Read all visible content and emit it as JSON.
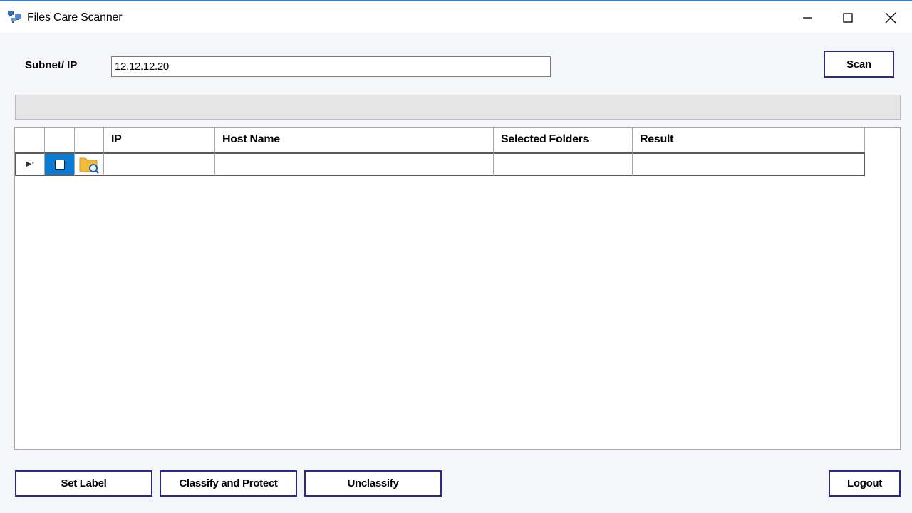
{
  "window": {
    "title": "Files Care Scanner",
    "icon": "network-computers-icon",
    "controls": [
      "minimize-icon",
      "maximize-icon",
      "close-icon"
    ],
    "accent_color": "#3b78d8"
  },
  "form": {
    "subnet_label": "Subnet/ IP",
    "subnet_value": "12.12.12.20",
    "scan_label": "Scan"
  },
  "progress": {
    "value_percent": 0
  },
  "grid": {
    "columns": [
      "",
      "",
      "",
      "IP",
      "Host Name",
      "Selected Folders",
      "Result"
    ],
    "new_row": {
      "marker": "▶*",
      "checked": false,
      "ip": "",
      "host_name": "",
      "selected_folders": "",
      "result": ""
    },
    "selection_color": "#0a7bd4"
  },
  "actions": {
    "set_label": "Set Label",
    "classify_label": "Classify and Protect",
    "unclassify_label": "Unclassify",
    "logout_label": "Logout"
  },
  "colors": {
    "button_border": "#2a2a86",
    "background": "#f5f6fa"
  }
}
